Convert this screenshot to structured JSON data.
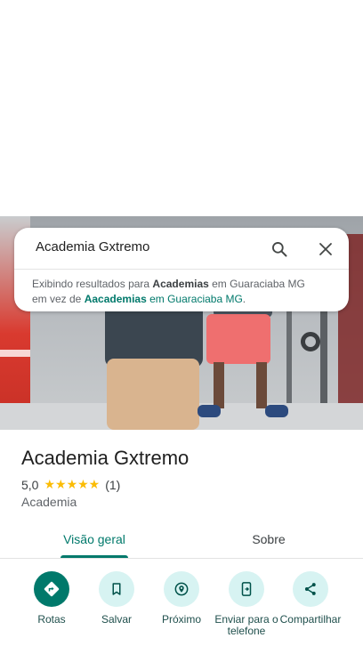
{
  "search": {
    "query": "Academia Gxtremo",
    "suggestion": {
      "prefix": "Exibindo resultados para ",
      "bold_term": "Academias",
      "location": " em Guaraciaba MG",
      "line2_prefix": "em vez de ",
      "alt_term": "Aacademias",
      "alt_location": " em Guaraciaba MG",
      "suffix": "."
    }
  },
  "place": {
    "name": "Academia Gxtremo",
    "rating": "5,0",
    "stars": "★★★★★",
    "review_count": "(1)",
    "category": "Academia"
  },
  "tabs": [
    {
      "label": "Visão geral",
      "selected": true
    },
    {
      "label": "Sobre",
      "selected": false
    }
  ],
  "actions": [
    {
      "label": "Rotas",
      "icon": "directions-icon"
    },
    {
      "label": "Salvar",
      "icon": "bookmark-icon"
    },
    {
      "label": "Próximo",
      "icon": "nearby-icon"
    },
    {
      "label": "Enviar para o\ntelefone",
      "icon": "send-to-phone-icon"
    },
    {
      "label": "Compartilhar",
      "icon": "share-icon"
    }
  ],
  "colors": {
    "accent": "#00796b",
    "star": "#fbbc04",
    "chip_bg": "#d7f3f2"
  }
}
